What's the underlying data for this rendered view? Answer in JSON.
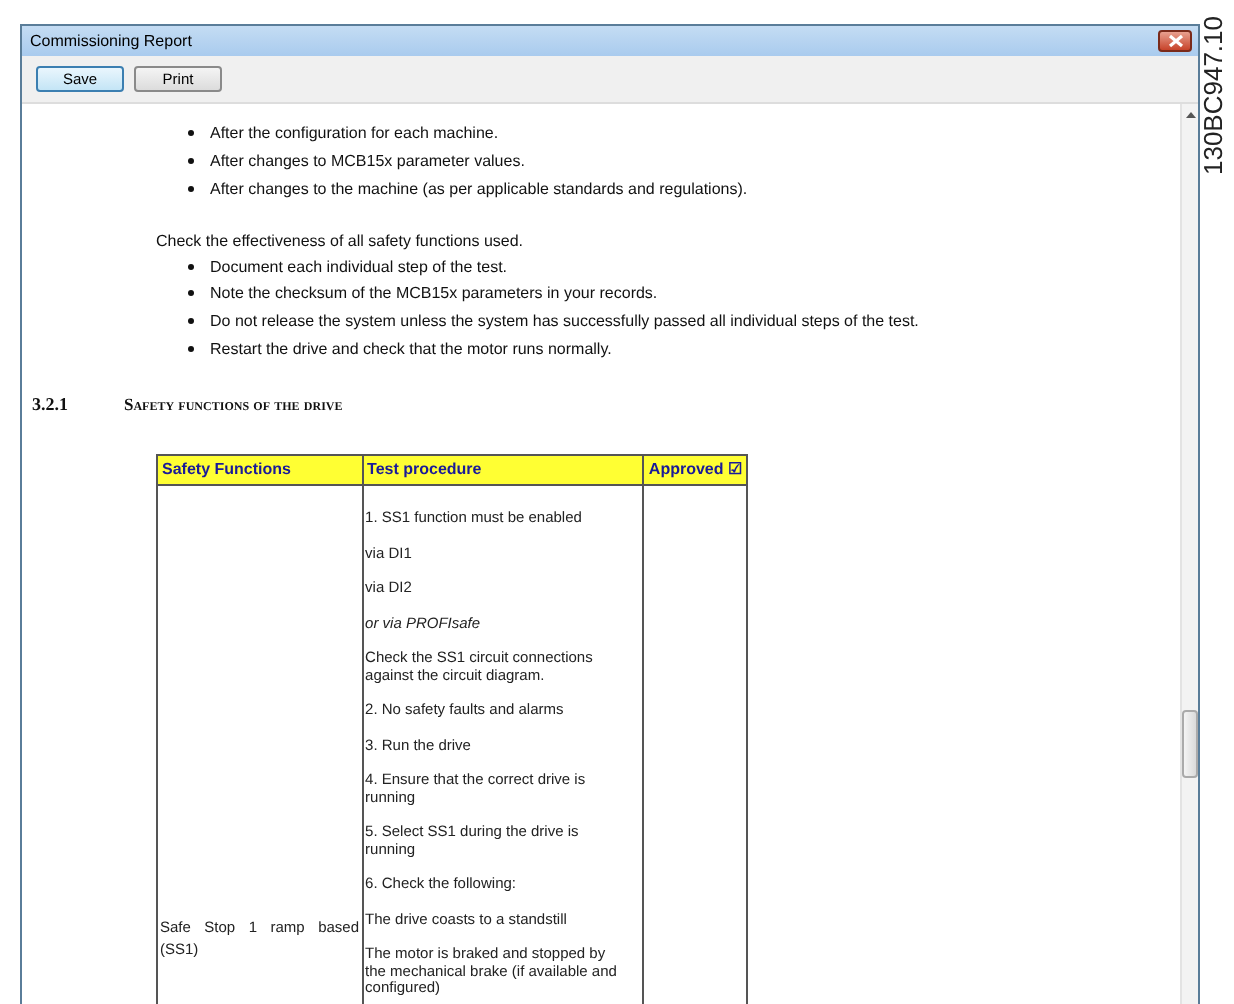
{
  "window": {
    "title": "Commissioning Report"
  },
  "toolbar": {
    "buttons": [
      {
        "label": "Save",
        "selected": true
      },
      {
        "label": "Print",
        "selected": false
      }
    ]
  },
  "document": {
    "bullets_1": [
      "After the configuration for each machine.",
      "After changes to MCB15x parameter values.",
      "After changes to the machine (as per applicable standards and regulations)."
    ],
    "paragraph": "Check the effectiveness of all safety functions used.",
    "bullets_2": [
      "Document each individual step of the test.",
      "Note the checksum of the MCB15x parameters in your records.",
      "Do not release the system unless the system has successfully passed all individual steps of the test.",
      "Restart the drive and check that the motor runs normally."
    ],
    "heading": {
      "number": "3.2.1",
      "title": "Safety functions of the drive"
    },
    "table": {
      "columns": [
        "Safety Functions",
        "Test procedure",
        "Approved ☑"
      ],
      "rows": [
        {
          "function": "Safe Stop 1 ramp based (SS1)",
          "procedure": [
            {
              "text": "1. SS1 function must be enabled",
              "italic": false
            },
            {
              "text": "via DI1",
              "italic": false
            },
            {
              "text": "via DI2",
              "italic": false
            },
            {
              "text": "or via PROFIsafe",
              "italic": true
            },
            {
              "text": "Check the SS1 circuit connections against the circuit diagram.",
              "italic": false
            },
            {
              "text": "2. No safety faults and alarms",
              "italic": false
            },
            {
              "text": "3. Run the drive",
              "italic": false
            },
            {
              "text": "4. Ensure that the correct drive is running",
              "italic": false
            },
            {
              "text": "5. Select SS1 during the drive is running",
              "italic": false
            },
            {
              "text": "6. Check the following:",
              "italic": false
            },
            {
              "text": "The drive coasts to a standstill",
              "italic": false
            },
            {
              "text": "The motor is braked and stopped by the mechanical brake (if available and configured)",
              "italic": false
            }
          ]
        }
      ]
    }
  },
  "side_label": "130BC947.10"
}
